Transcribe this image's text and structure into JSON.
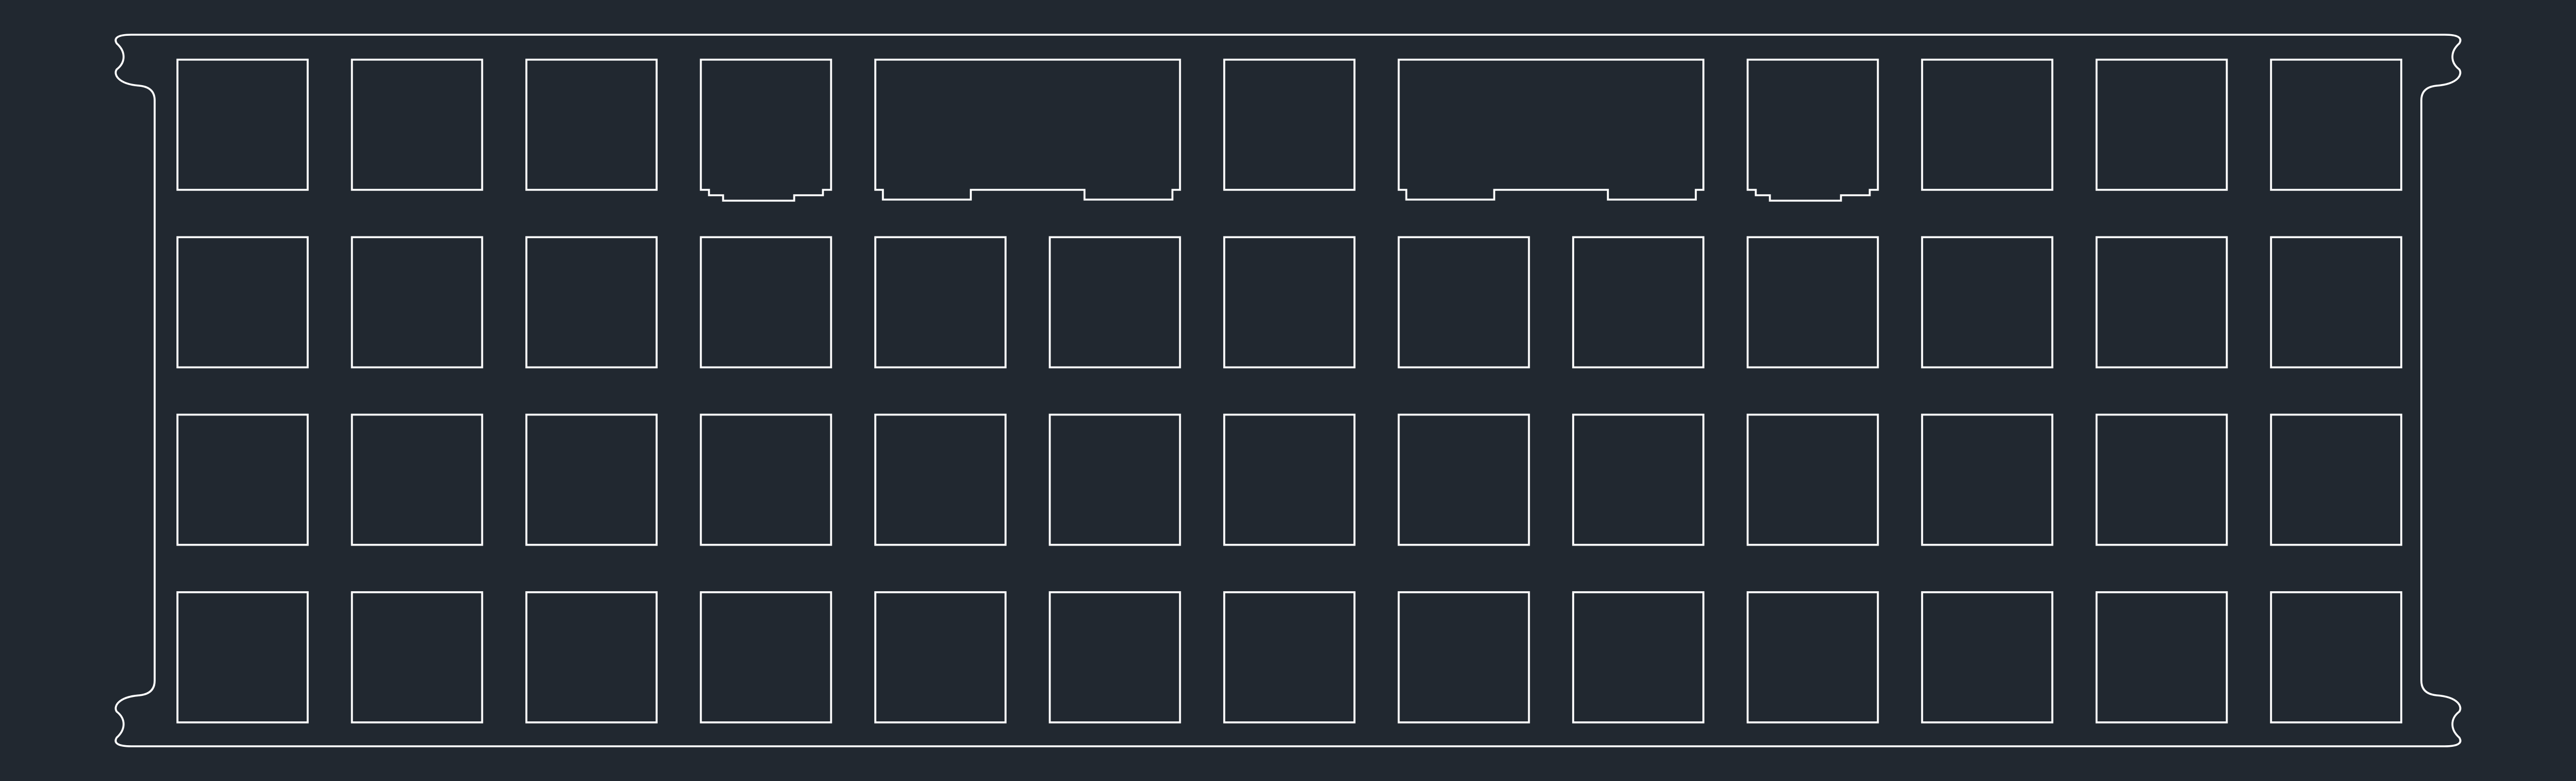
{
  "drawing": {
    "background_color": "#212830",
    "line_color": "#ffffff",
    "grid": {
      "rows": 4,
      "columns": 13
    },
    "keys": [
      {
        "row": 1,
        "kind": "square"
      },
      {
        "row": 1,
        "kind": "square"
      },
      {
        "row": 1,
        "kind": "square"
      },
      {
        "row": 1,
        "kind": "square-notched"
      },
      {
        "row": 1,
        "kind": "wide-stabilized"
      },
      {
        "row": 1,
        "kind": "square"
      },
      {
        "row": 1,
        "kind": "wide-stabilized"
      },
      {
        "row": 1,
        "kind": "square-notched"
      },
      {
        "row": 1,
        "kind": "square"
      },
      {
        "row": 1,
        "kind": "square"
      },
      {
        "row": 1,
        "kind": "square"
      },
      {
        "row": 2,
        "kind": "square",
        "count": 13
      },
      {
        "row": 3,
        "kind": "square",
        "count": 13
      },
      {
        "row": 4,
        "kind": "square",
        "count": 13
      }
    ]
  }
}
